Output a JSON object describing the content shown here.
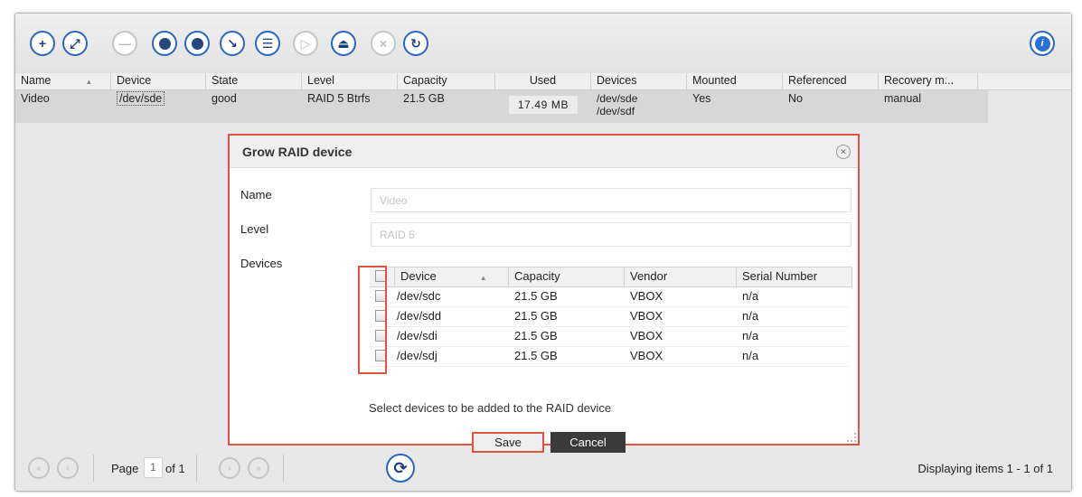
{
  "toolbar": {
    "buttons": [
      {
        "icon": "plus-icon",
        "glyph": "+"
      },
      {
        "icon": "expand-icon",
        "glyph": "⤢"
      },
      {
        "icon": "minus-icon",
        "glyph": "—"
      },
      {
        "icon": "puzzle-icon",
        "glyph": "✚"
      },
      {
        "icon": "database-icon",
        "glyph": "≡"
      },
      {
        "icon": "wrench-icon",
        "glyph": "🔧"
      },
      {
        "icon": "list-icon",
        "glyph": "☰"
      },
      {
        "icon": "play-icon",
        "glyph": "▷"
      },
      {
        "icon": "eject-icon",
        "glyph": "⏏"
      },
      {
        "icon": "close-icon",
        "glyph": "×"
      },
      {
        "icon": "recover-icon",
        "glyph": "↻"
      }
    ]
  },
  "grid": {
    "columns": [
      "Name",
      "Device",
      "State",
      "Level",
      "Capacity",
      "Used",
      "Devices",
      "Mounted",
      "Referenced",
      "Recovery m..."
    ],
    "row": {
      "name": "Video",
      "device": "/dev/sde",
      "state": "good",
      "level": "RAID 5 Btrfs",
      "capacity": "21.5 GB",
      "used": "17.49 MB",
      "devices_1": "/dev/sde",
      "devices_2": "/dev/sdf",
      "mounted": "Yes",
      "referenced": "No",
      "recovery": "manual"
    }
  },
  "dialog": {
    "title": "Grow RAID device",
    "name_label": "Name",
    "name_value": "Video",
    "level_label": "Level",
    "level_value": "RAID 5",
    "devices_label": "Devices",
    "columns": [
      "Device",
      "Capacity",
      "Vendor",
      "Serial Number"
    ],
    "rows": [
      {
        "device": "/dev/sdc",
        "capacity": "21.5 GB",
        "vendor": "VBOX",
        "serial": "n/a"
      },
      {
        "device": "/dev/sdd",
        "capacity": "21.5 GB",
        "vendor": "VBOX",
        "serial": "n/a"
      },
      {
        "device": "/dev/sdi",
        "capacity": "21.5 GB",
        "vendor": "VBOX",
        "serial": "n/a"
      },
      {
        "device": "/dev/sdj",
        "capacity": "21.5 GB",
        "vendor": "VBOX",
        "serial": "n/a"
      }
    ],
    "hint": "Select devices to be added to the RAID device",
    "save_label": "Save",
    "cancel_label": "Cancel"
  },
  "pager": {
    "page_label": "Page",
    "page_value": "1",
    "of_label": "of 1",
    "display_text": "Displaying items 1 - 1 of 1"
  },
  "colors": {
    "accent": "#2b66c2",
    "highlight": "#e0533f"
  }
}
